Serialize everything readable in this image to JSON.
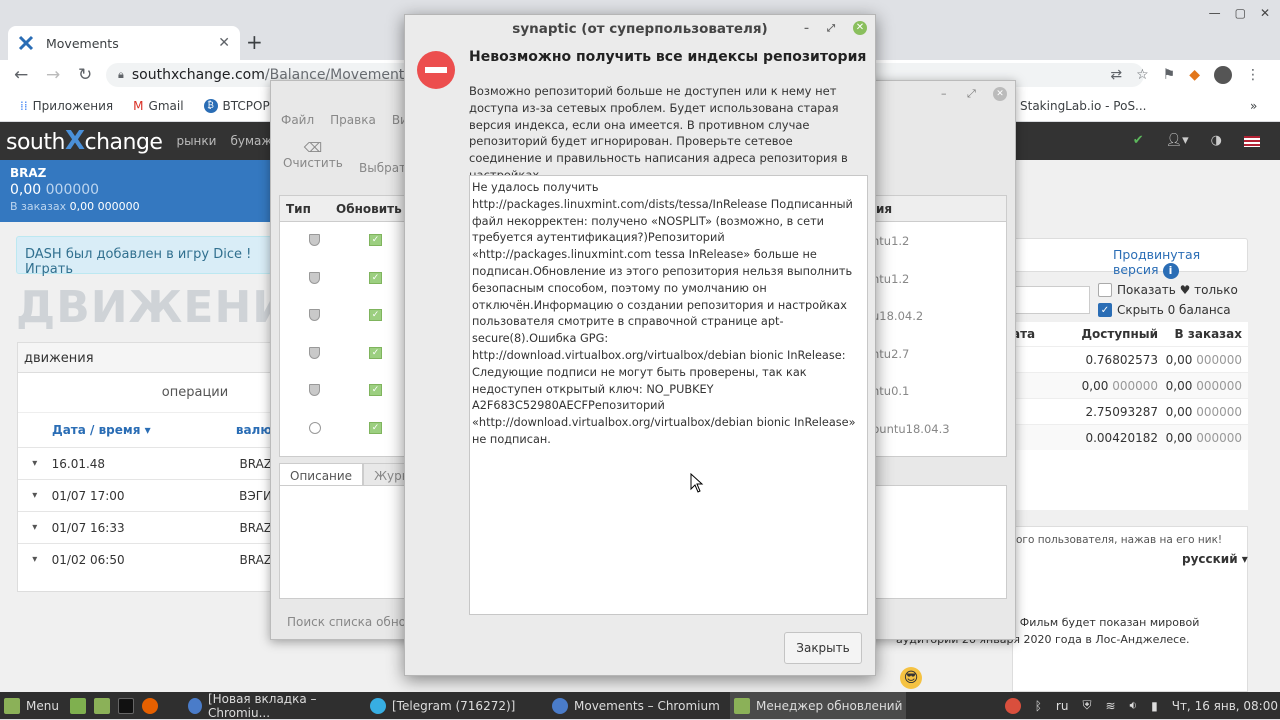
{
  "browser": {
    "tab_title": "Movements",
    "window_title": "Movements – Chromium",
    "url_host": "southxchange.com",
    "url_path": "/Balance/Movements",
    "bookmarks": [
      "Приложения",
      "Gmail",
      "BTCPOP -",
      "StakingLab.io - PoS..."
    ]
  },
  "site": {
    "logo": {
      "left": "south",
      "x": "X",
      "right": "change"
    },
    "nav": [
      "рынки",
      "бумажники"
    ],
    "balance": {
      "coin": "BRAZ",
      "amount": "0,00",
      "amount_dim": "000000",
      "in_orders_label": "В заказах",
      "in_orders_value": "0,00 000000"
    },
    "alert": "DASH был добавлен в игру Dice ! Играть",
    "page_title": "ДВИЖЕНИЯ",
    "movements": {
      "header": "движения",
      "ops_label": "операции",
      "col_date": "Дата / время",
      "col_currency": "валю",
      "rows": [
        {
          "date": "16.01.48",
          "cur": "BRAZ"
        },
        {
          "date": "01/07 17:00",
          "cur": "ВЭГИ"
        },
        {
          "date": "01/07 16:33",
          "cur": "BRAZ"
        },
        {
          "date": "01/02 06:50",
          "cur": "BRAZ"
        }
      ]
    },
    "advanced_version": "Продвинутая версия",
    "show_fav": "Показать ♥ только",
    "hide_zero": "Скрыть 0 баланса",
    "balance_table": {
      "col_cur": "ата",
      "col_avail": "Доступный",
      "col_orders": "В заказах",
      "rows": [
        {
          "avail": "0.76802573",
          "avail_dim": "",
          "orders": "0,00",
          "orders_dim": "000000"
        },
        {
          "avail": "0,00",
          "avail_dim": "000000",
          "orders": "0,00",
          "orders_dim": "000000"
        },
        {
          "avail": "2.75093287",
          "avail_dim": "",
          "orders": "0,00",
          "orders_dim": "000000"
        },
        {
          "avail": "0.00420182",
          "avail_dim": "",
          "orders": "0,00",
          "orders_dim": "000000"
        }
      ]
    },
    "chat_hint": "ого пользователя, нажав на его ник!",
    "language": "русский",
    "chat_text": "а» Питера Джозефа. Фильм будет показан мировой аудитории 26 января 2020 года в Лос-Анджелесе."
  },
  "synaptic_main": {
    "menu": [
      "Файл",
      "Правка",
      "Вид"
    ],
    "clear_btn": "Очистить",
    "select_btn": "Выбрать",
    "col_type": "Тип",
    "col_update": "Обновить",
    "col_version": "ия",
    "versions": [
      "ntu1.2",
      "ntu1.2",
      "u18.04.2",
      "ntu2.7",
      "ntu0.1",
      "buntu18.04.3"
    ],
    "tab_desc": "Описание",
    "tab_journal": "Журнал",
    "search_text": "Поиск списка обновлений"
  },
  "dialog": {
    "title": "synaptic (от суперпользователя)",
    "heading": "Невозможно получить все индексы репозитория",
    "body": "Возможно репозиторий больше не доступен или к нему нет доступа из-за сетевых проблем. Будет использована старая версия индекса, если она имеется. В противном случае репозиторий будет игнорирован. Проверьте сетевое соединение и правильность написания адреса репозитория в настройках.",
    "details": "Не удалось получить http://packages.linuxmint.com/dists/tessa/InRelease Подписанный файл некорректен: получено «NOSPLIT» (возможно, в сети требуется аутентификация?)Репозиторий «http://packages.linuxmint.com tessa InRelease» больше не подписан.Обновление из этого репозитория нельзя выполнить безопасным способом, поэтому по умолчанию он отключён.Информацию о создании репозитория и настройках пользователя смотрите в справочной странице apt-secure(8).Ошибка GPG: http://download.virtualbox.org/virtualbox/debian bionic InRelease: Следующие подписи не могут быть проверены, так как недоступен открытый ключ: NO_PUBKEY A2F683C52980AECFРепозиторий «http://download.virtualbox.org/virtualbox/debian bionic InRelease» не подписан.",
    "close_btn": "Закрыть"
  },
  "taskbar": {
    "menu": "Menu",
    "items": [
      "[Новая вкладка – Chromiu...",
      "[Telegram (716272)]",
      "Movements – Chromium",
      "Менеджер обновлений"
    ],
    "lang": "ru",
    "clock": "Чт, 16 янв, 08:00"
  },
  "colors": {
    "accent": "#3478c0",
    "brand_x": "#4a90d9",
    "stop": "#ec4e4e",
    "taskbar": "#2f2f2f"
  }
}
